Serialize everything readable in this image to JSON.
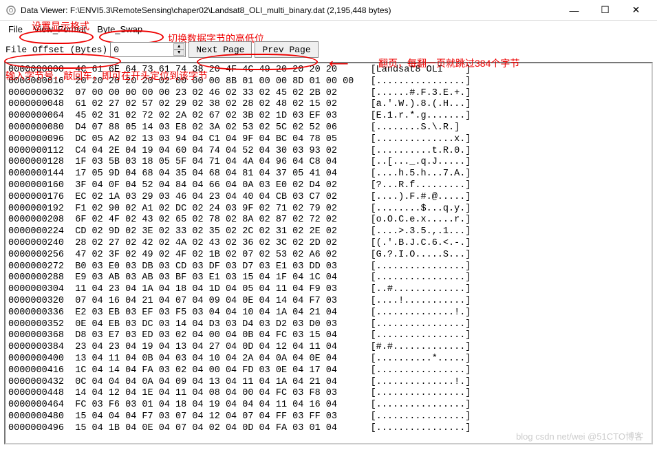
{
  "window": {
    "title": "Data Viewer: F:\\ENVI5.3\\RemoteSensing\\chaper02\\Landsat8_OLI_multi_binary.dat (2,195,448 bytes)"
  },
  "menu": {
    "file": "File",
    "view_format": "View_Format",
    "byte_swap": "Byte_Swap"
  },
  "toolbar": {
    "offset_label": "File Offset (Bytes)",
    "offset_value": "0",
    "next_page": "Next Page",
    "prev_page": "Prev Page"
  },
  "annotations": {
    "set_display_format": "设置显示格式",
    "swap_bytes": "切换数据字节的高低位",
    "paging": "翻页，每翻一页就跳过384个字节",
    "input_offset": "输入字节号，敲回车，即可在开头定位到该字节"
  },
  "watermark": "blog csdn net/wei @51CTO博客",
  "hex_rows": [
    {
      "off": "0000000000",
      "hex": "4C 61 6E 64 73 61 74 38 20 4F 4C 49 20 20 20 20",
      "asc": "[Landsat8 OLI    ]"
    },
    {
      "off": "0000000016",
      "hex": "20 20 20 20 20 02 00 00 00 8B 01 00 00 8D 01 00 00",
      "asc": "[................]"
    },
    {
      "off": "0000000032",
      "hex": "07 00 00 00 00 00 23 02 46 02 33 02 45 02 2B 02",
      "asc": "[......#.F.3.E.+.]"
    },
    {
      "off": "0000000048",
      "hex": "61 02 27 02 57 02 29 02 38 02 28 02 48 02 15 02",
      "asc": "[a.'.W.).8.(.H...]"
    },
    {
      "off": "0000000064",
      "hex": "45 02 31 02 72 02 2A 02 67 02 3B 02 1D 03 EF 03",
      "asc": "[E.1.r.*.g.......]"
    },
    {
      "off": "0000000080",
      "hex": "D4 07 88 05 14 03 E8 02 3A 02 53 02 5C 02 52 06",
      "asc": "[........S.\\.R.]"
    },
    {
      "off": "0000000096",
      "hex": "DC 05 A2 02 13 03 94 04 C1 04 9F 04 BC 04 78 05",
      "asc": "[..............x.]"
    },
    {
      "off": "0000000112",
      "hex": "C4 04 2E 04 19 04 60 04 74 04 52 04 30 03 93 02",
      "asc": "[..........t.R.0.]"
    },
    {
      "off": "0000000128",
      "hex": "1F 03 5B 03 18 05 5F 04 71 04 4A 04 96 04 C8 04",
      "asc": "[..[..._.q.J.....]"
    },
    {
      "off": "0000000144",
      "hex": "17 05 9D 04 68 04 35 04 68 04 81 04 37 05 41 04",
      "asc": "[....h.5.h...7.A.]"
    },
    {
      "off": "0000000160",
      "hex": "3F 04 0F 04 52 04 84 04 66 04 0A 03 E0 02 D4 02",
      "asc": "[?...R.f.........]"
    },
    {
      "off": "0000000176",
      "hex": "EC 02 1A 03 29 03 46 04 23 04 40 04 CB 03 C7 02",
      "asc": "[....).F.#.@.....]"
    },
    {
      "off": "0000000192",
      "hex": "F1 02 90 02 A1 02 DC 02 24 03 9F 02 71 02 79 02",
      "asc": "[........$...q.y.]"
    },
    {
      "off": "0000000208",
      "hex": "6F 02 4F 02 43 02 65 02 78 02 8A 02 87 02 72 02",
      "asc": "[o.O.C.e.x.....r.]"
    },
    {
      "off": "0000000224",
      "hex": "CD 02 9D 02 3E 02 33 02 35 02 2C 02 31 02 2E 02",
      "asc": "[....>.3.5.,.1...]"
    },
    {
      "off": "0000000240",
      "hex": "28 02 27 02 42 02 4A 02 43 02 36 02 3C 02 2D 02",
      "asc": "[(.'.B.J.C.6.<.-.]"
    },
    {
      "off": "0000000256",
      "hex": "47 02 3F 02 49 02 4F 02 1B 02 07 02 53 02 A6 02",
      "asc": "[G.?.I.O.....S...]"
    },
    {
      "off": "0000000272",
      "hex": "B0 03 E0 03 DB 03 CD 03 DF 03 D7 03 E1 03 DD 03",
      "asc": "[................]"
    },
    {
      "off": "0000000288",
      "hex": "E9 03 AB 03 AB 03 BF 03 E1 03 15 04 1F 04 1C 04",
      "asc": "[................]"
    },
    {
      "off": "0000000304",
      "hex": "11 04 23 04 1A 04 18 04 1D 04 05 04 11 04 F9 03",
      "asc": "[..#.............]"
    },
    {
      "off": "0000000320",
      "hex": "07 04 16 04 21 04 07 04 09 04 0E 04 14 04 F7 03",
      "asc": "[....!...........]"
    },
    {
      "off": "0000000336",
      "hex": "E2 03 EB 03 EF 03 F5 03 04 04 10 04 1A 04 21 04",
      "asc": "[..............!.]"
    },
    {
      "off": "0000000352",
      "hex": "0E 04 EB 03 DC 03 14 04 D3 03 D4 03 D2 03 D0 03",
      "asc": "[................]"
    },
    {
      "off": "0000000368",
      "hex": "D8 03 E7 03 ED 03 02 04 00 04 0B 04 FC 03 15 04",
      "asc": "[................]"
    },
    {
      "off": "0000000384",
      "hex": "23 04 23 04 19 04 13 04 27 04 0D 04 12 04 11 04",
      "asc": "[#.#.............]"
    },
    {
      "off": "0000000400",
      "hex": "13 04 11 04 0B 04 03 04 10 04 2A 04 0A 04 0E 04",
      "asc": "[..........*.....]"
    },
    {
      "off": "0000000416",
      "hex": "1C 04 14 04 FA 03 02 04 00 04 FD 03 0E 04 17 04",
      "asc": "[................]"
    },
    {
      "off": "0000000432",
      "hex": "0C 04 04 04 0A 04 09 04 13 04 11 04 1A 04 21 04",
      "asc": "[..............!.]"
    },
    {
      "off": "0000000448",
      "hex": "14 04 12 04 1E 04 11 04 08 04 00 04 FC 03 F8 03",
      "asc": "[................]"
    },
    {
      "off": "0000000464",
      "hex": "FC 03 F6 03 01 04 18 04 19 04 04 04 11 04 16 04",
      "asc": "[................]"
    },
    {
      "off": "0000000480",
      "hex": "15 04 04 04 F7 03 07 04 12 04 07 04 FF 03 FF 03",
      "asc": "[................]"
    },
    {
      "off": "0000000496",
      "hex": "15 04 1B 04 0E 04 07 04 02 04 0D 04 FA 03 01 04",
      "asc": "[................]"
    }
  ]
}
